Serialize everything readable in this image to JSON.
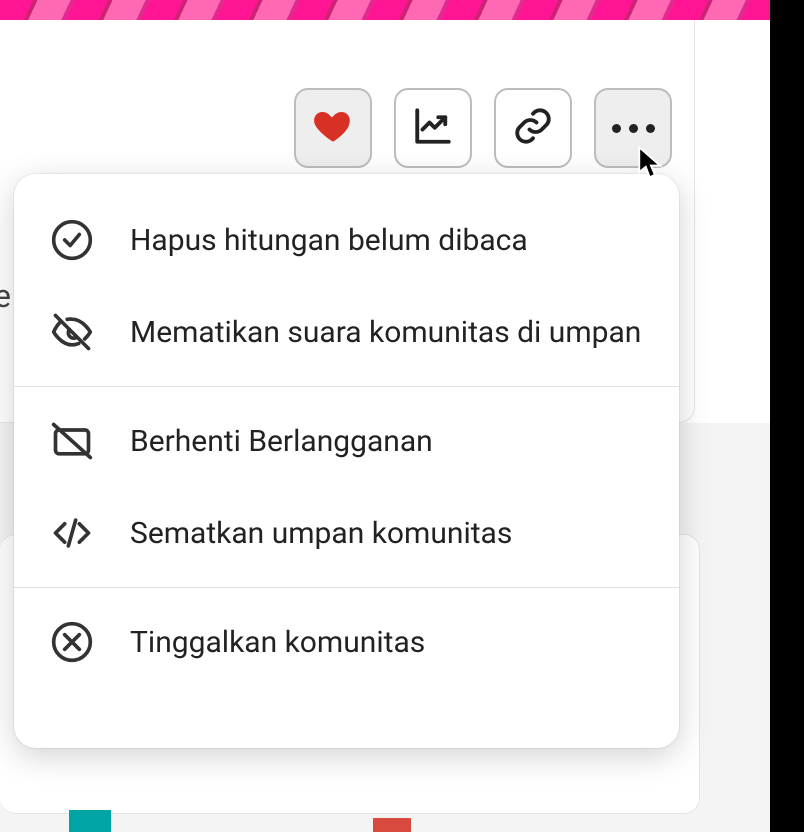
{
  "toolbar": {
    "like": "like",
    "analytics": "analytics",
    "link": "link",
    "more": "more"
  },
  "menu": {
    "items": [
      {
        "icon": "check-circle-icon",
        "label": "Hapus hitungan belum dibaca"
      },
      {
        "icon": "eye-off-icon",
        "label": "Mematikan suara komunitas di umpan"
      },
      {
        "icon": "mail-off-icon",
        "label": "Berhenti Berlangganan"
      },
      {
        "icon": "code-icon",
        "label": "Sematkan umpan komunitas"
      },
      {
        "icon": "x-circle-icon",
        "label": "Tinggalkan komunitas"
      }
    ]
  },
  "partial_text": "e"
}
